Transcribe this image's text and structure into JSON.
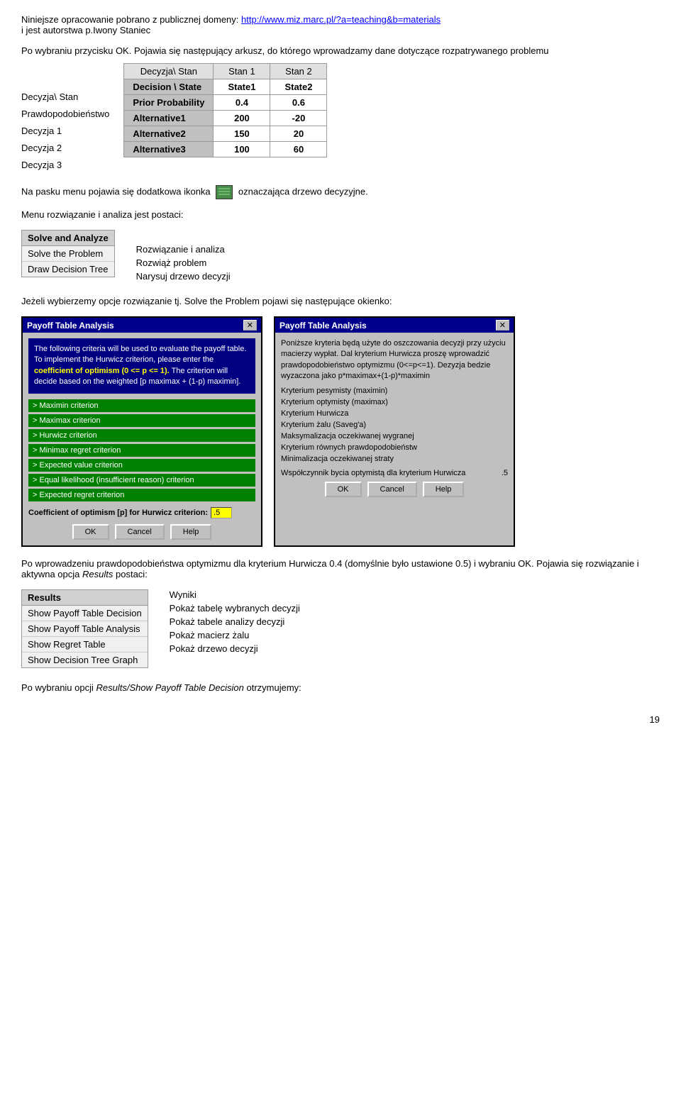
{
  "header": {
    "line1": "Niniejsze opracowanie pobrano z publicznej domeny: http://www.miz.marc.pl/?a=teaching&b=materials",
    "line1_link": "http://www.miz.marc.pl/?a=teaching&b=materials",
    "line2": "i jest autorstwa p.Iwony Staniec"
  },
  "intro": {
    "para1": "Po wybraniu przycisku OK. Pojawia się następujący arkusz, do którego wprowadzamy dane dotyczące rozpatrywanego problemu"
  },
  "left_labels": {
    "row0": "Decyzja\\ Stan",
    "row1": "Prawdopodobieństwo",
    "row2": "Decyzja 1",
    "row3": "Decyzja 2",
    "row4": "Decyzja 3"
  },
  "table": {
    "col_header_label": "Decyzja\\ Stan",
    "col_header_stan1": "Stan 1",
    "col_header_stan2": "Stan 2",
    "rows": [
      {
        "label": "Decision \\ State",
        "v1": "State1",
        "v2": "State2"
      },
      {
        "label": "Prior Probability",
        "v1": "0.4",
        "v2": "0.6"
      },
      {
        "label": "Alternative1",
        "v1": "200",
        "v2": "-20"
      },
      {
        "label": "Alternative2",
        "v1": "150",
        "v2": "20"
      },
      {
        "label": "Alternative3",
        "v1": "100",
        "v2": "60"
      }
    ]
  },
  "icon_menu_text": "Na pasku menu pojawia się dodatkowa ikonka",
  "icon_menu_text2": "oznaczająca drzewo decyzyjne.",
  "menu_solve": {
    "title": "Solve and Analyze",
    "items": [
      "Solve the Problem",
      "Draw Decision Tree"
    ]
  },
  "solve_right": {
    "heading": "Rozwiązanie i analiza",
    "item1": "Rozwiąż problem",
    "item2": "Narysuj drzewo decyzji"
  },
  "menu_caption": "Menu rozwiązanie i analiza jest postaci:",
  "solve_intro": "Jeżeli wybierzemy opcje rozwiązanie tj. Solve the Problem pojawi się następujące okienko:",
  "dialog_left": {
    "title": "Payoff Table Analysis",
    "info_line1": "The following criteria will be used to evaluate the payoff table. To implement the Hurwicz criterion, please enter the",
    "info_line2": "coefficient of optimism (0 <= p <= 1).",
    "info_line3": "The criterion will decide based on the weighted [p maximax + (1-p) maximin].",
    "criteria": [
      "Maximin criterion",
      "Maximax criterion",
      "Hurwicz criterion",
      "Minimax regret criterion",
      "Expected value criterion",
      "Equal likelihood (insufficient reason) criterion",
      "Expected regret criterion"
    ],
    "coeff_label": "Coefficient of optimism [p] for Hurwicz criterion:",
    "coeff_value": ".5",
    "btn_ok": "OK",
    "btn_cancel": "Cancel",
    "btn_help": "Help"
  },
  "dialog_right": {
    "title": "Payoff Table Analysis",
    "desc": "Poniższe kryteria będą użyte do oszczowania decyzji przy użyciu macierzy wypłat. Dal kryterium Hurwicza proszę wprowadzić prawdopodobieństwo optymizmu (0<=p<=1). Dezyzja bedzie wyzaczona jako p*maximax+(1-p)*maximin",
    "criteria": [
      "Kryterium pesymisty (maximin)",
      "Kryterium optymisty (maximax)",
      "Kryterium Hurwicza",
      "Kryterium żalu (Saveg'a)",
      "Maksymalizacja oczekiwanej wygranej",
      "Kryterium równych prawdopodobieństw",
      "Minimalizacja oczekiwanej straty"
    ],
    "coeff_label": "Współczynnik bycia optymistą dla kryterium Hurwicza",
    "coeff_value": ".5",
    "btn_ok": "OK",
    "btn_cancel": "Cancel",
    "btn_help": "Help"
  },
  "after_dialog": "Po wprowadzeniu prawdopodobieństwa optymizmu dla kryterium Hurwicza 0.4 (domyślnie było ustawione 0.5) i wybraniu OK. Pojawia się rozwiązanie i aktywna opcja",
  "results_italic": "Results",
  "results_postaci": "postaci:",
  "results_menu": {
    "title": "Results",
    "items": [
      "Show Payoff Table Decision",
      "Show Payoff Table Analysis",
      "Show Regret Table",
      "Show Decision Tree Graph"
    ]
  },
  "results_right": {
    "heading": "Wyniki",
    "item1": "Pokaż tabelę wybranych decyzji",
    "item2": "Pokaż tabele analizy decyzji",
    "item3": "Pokaż macierz żalu",
    "item4": "Pokaż drzewo decyzji"
  },
  "footer_text": "Po wybraniu opcji",
  "footer_italic": "Results/Show Payoff Table Decision",
  "footer_text2": "otrzymujemy:",
  "page_number": "19"
}
